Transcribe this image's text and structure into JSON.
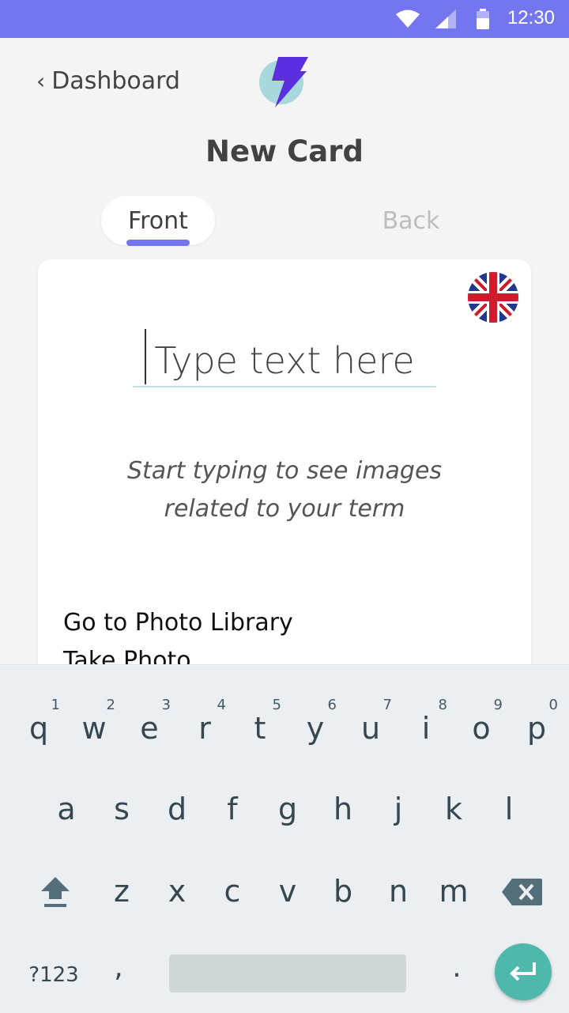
{
  "status_bar": {
    "time": "12:30",
    "color": "#7376ee"
  },
  "header": {
    "back_label": "Dashboard",
    "logo_icon": "lightning-bolt-icon",
    "title": "New Card"
  },
  "tabs": [
    {
      "label": "Front",
      "active": true
    },
    {
      "label": "Back",
      "active": false
    }
  ],
  "card": {
    "language_flag": "uk-flag-icon",
    "input": {
      "placeholder": "Type text here",
      "value": ""
    },
    "hint_line1": "Start typing to see images",
    "hint_line2": "related to your term",
    "options": [
      "Go to Photo Library",
      "Take Photo"
    ]
  },
  "keyboard": {
    "row1": [
      "q",
      "w",
      "e",
      "r",
      "t",
      "y",
      "u",
      "i",
      "o",
      "p"
    ],
    "row1_hints": [
      "1",
      "2",
      "3",
      "4",
      "5",
      "6",
      "7",
      "8",
      "9",
      "0"
    ],
    "row2": [
      "a",
      "s",
      "d",
      "f",
      "g",
      "h",
      "j",
      "k",
      "l"
    ],
    "row3": [
      "z",
      "x",
      "c",
      "v",
      "b",
      "n",
      "m"
    ],
    "symbols_label": "?123",
    "comma": ",",
    "period": ".",
    "enter_color": "#4fb8ac"
  }
}
